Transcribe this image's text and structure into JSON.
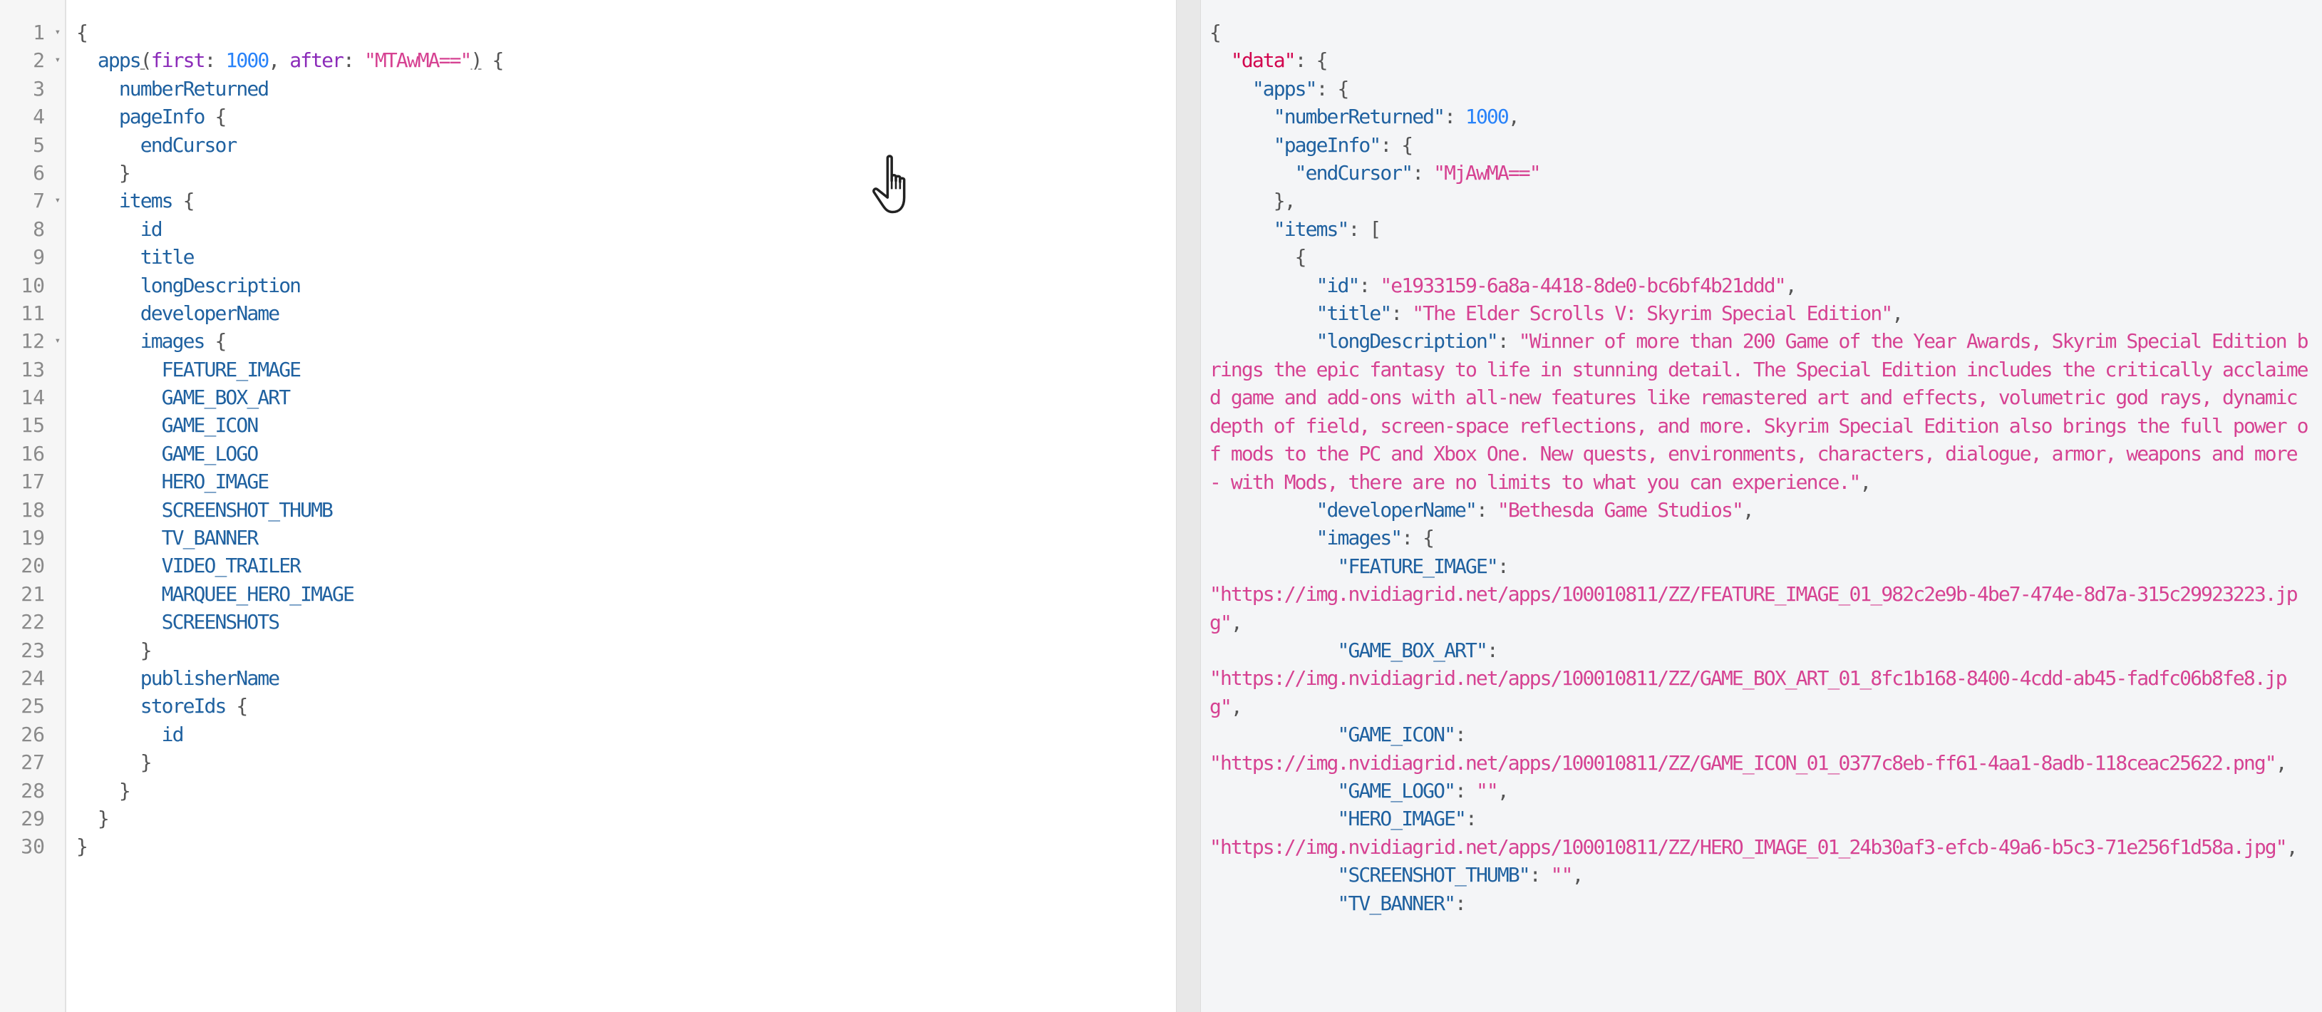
{
  "query_editor": {
    "line_count": 30,
    "fold_lines": [
      1,
      2,
      7,
      12
    ],
    "query": {
      "root_field": "apps",
      "args": [
        {
          "name": "first",
          "value": "1000",
          "type": "number"
        },
        {
          "name": "after",
          "value": "\"MTAwMA==\"",
          "type": "string"
        }
      ],
      "fields": {
        "numberReturned": "numberReturned",
        "pageInfo": "pageInfo",
        "endCursor": "endCursor",
        "items": "items",
        "id": "id",
        "title": "title",
        "longDescription": "longDescription",
        "developerName": "developerName",
        "images": "images",
        "publisherName": "publisherName",
        "storeIds": "storeIds",
        "storeId": "id"
      },
      "image_fields": [
        "FEATURE_IMAGE",
        "GAME_BOX_ART",
        "GAME_ICON",
        "GAME_LOGO",
        "HERO_IMAGE",
        "SCREENSHOT_THUMB",
        "TV_BANNER",
        "VIDEO_TRAILER",
        "MARQUEE_HERO_IMAGE",
        "SCREENSHOTS"
      ]
    }
  },
  "result_pane": {
    "data_key": "data",
    "apps_key": "apps",
    "numberReturned": 1000,
    "endCursor": "MjAwMA==",
    "item": {
      "id": "e1933159-6a8a-4418-8de0-bc6bf4b21ddd",
      "title": "The Elder Scrolls V: Skyrim Special Edition",
      "longDescription": "Winner of more than 200 Game of the Year Awards, Skyrim Special Edition brings the epic fantasy to life in stunning detail. The Special Edition includes the critically acclaimed game and add-ons with all-new features like remastered art and effects, volumetric god rays, dynamic depth of field, screen-space reflections, and more. Skyrim Special Edition also brings the full power of mods to the PC and Xbox One. New quests, environments, characters, dialogue, armor, weapons and more - with Mods, there are no limits to what you can experience.",
      "developerName": "Bethesda Game Studios",
      "images": [
        {
          "key": "FEATURE_IMAGE",
          "value": "https://img.nvidiagrid.net/apps/100010811/ZZ/FEATURE_IMAGE_01_982c2e9b-4be7-474e-8d7a-315c29923223.jpg"
        },
        {
          "key": "GAME_BOX_ART",
          "value": "https://img.nvidiagrid.net/apps/100010811/ZZ/GAME_BOX_ART_01_8fc1b168-8400-4cdd-ab45-fadfc06b8fe8.jpg"
        },
        {
          "key": "GAME_ICON",
          "value": "https://img.nvidiagrid.net/apps/100010811/ZZ/GAME_ICON_01_0377c8eb-ff61-4aa1-8adb-118ceac25622.png"
        },
        {
          "key": "GAME_LOGO",
          "value": ""
        },
        {
          "key": "HERO_IMAGE",
          "value": "https://img.nvidiagrid.net/apps/100010811/ZZ/HERO_IMAGE_01_24b30af3-efcb-49a6-b5c3-71e256f1d58a.jpg"
        },
        {
          "key": "SCREENSHOT_THUMB",
          "value": ""
        },
        {
          "key": "TV_BANNER",
          "value": null
        }
      ]
    }
  },
  "colors": {
    "field": "#1f61a0",
    "argument": "#8b2bb9",
    "number": "#2882f9",
    "string": "#d64292",
    "root_key": "#d2054e",
    "punctuation": "#555555",
    "gutter_bg": "#f6f6f6",
    "result_bg": "#f4f5f7",
    "divider_bg": "#e8e8e8"
  },
  "cursor": {
    "icon": "hand-pointer-icon"
  }
}
